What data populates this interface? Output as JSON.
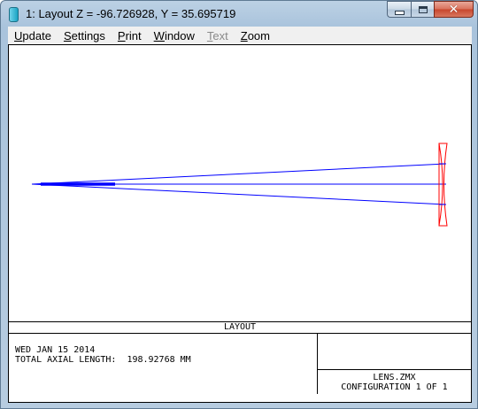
{
  "window": {
    "title": "1: Layout Z = -96.726928, Y = 35.695719",
    "controls": {
      "minimize": "minimize",
      "maximize": "maximize",
      "close": "close"
    }
  },
  "menu": {
    "items": [
      {
        "label": "Update",
        "accelerator": "U",
        "rest": "pdate",
        "enabled": true
      },
      {
        "label": "Settings",
        "accelerator": "S",
        "rest": "ettings",
        "enabled": true
      },
      {
        "label": "Print",
        "accelerator": "P",
        "rest": "rint",
        "enabled": true
      },
      {
        "label": "Window",
        "accelerator": "W",
        "rest": "indow",
        "enabled": true
      },
      {
        "label": "Text",
        "accelerator": "T",
        "rest": "ext",
        "enabled": false
      },
      {
        "label": "Zoom",
        "accelerator": "Z",
        "rest": "oom",
        "enabled": true
      }
    ]
  },
  "layout": {
    "ray_color": "#0000ff",
    "lens_color": "#ff0000"
  },
  "title_block": {
    "plot_title": "LAYOUT",
    "date": "WED JAN 15 2014",
    "axial_length_label": "TOTAL AXIAL LENGTH:",
    "axial_length_value": "198.92768 MM",
    "file_name": "LENS.ZMX",
    "configuration": "CONFIGURATION 1 OF 1"
  }
}
